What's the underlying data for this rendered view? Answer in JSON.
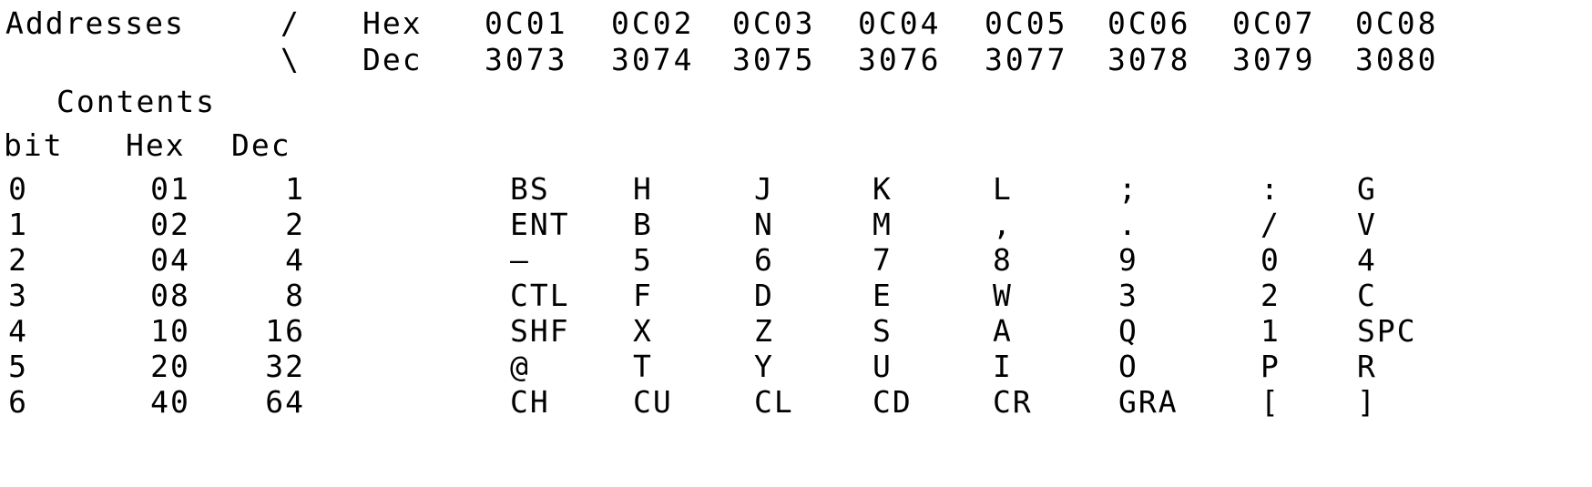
{
  "header": {
    "addresses_label": "Addresses",
    "slash": "/",
    "backslash": "\\",
    "hex_label": "Hex",
    "dec_label": "Dec",
    "hex_addresses": [
      "0C01",
      "0C02",
      "0C03",
      "0C04",
      "0C05",
      "0C06",
      "0C07",
      "0C08"
    ],
    "dec_addresses": [
      "3073",
      "3074",
      "3075",
      "3076",
      "3077",
      "3078",
      "3079",
      "3080"
    ]
  },
  "contents": {
    "label": "Contents",
    "col_bit": "bit",
    "col_hex": "Hex",
    "col_dec": "Dec"
  },
  "rows": [
    {
      "bit": "0",
      "hex": "01",
      "dec": "1",
      "keys": [
        "BS",
        "H",
        "J",
        "K",
        "L",
        ";",
        ":",
        "G"
      ]
    },
    {
      "bit": "1",
      "hex": "02",
      "dec": "2",
      "keys": [
        "ENT",
        "B",
        "N",
        "M",
        ",",
        ".",
        "/",
        "V"
      ]
    },
    {
      "bit": "2",
      "hex": "04",
      "dec": "4",
      "keys": [
        "—",
        "5",
        "6",
        "7",
        "8",
        "9",
        "0",
        "4"
      ]
    },
    {
      "bit": "3",
      "hex": "08",
      "dec": "8",
      "keys": [
        "CTL",
        "F",
        "D",
        "E",
        "W",
        "3",
        "2",
        "C"
      ]
    },
    {
      "bit": "4",
      "hex": "10",
      "dec": "16",
      "keys": [
        "SHF",
        "X",
        "Z",
        "S",
        "A",
        "Q",
        "1",
        "SPC"
      ]
    },
    {
      "bit": "5",
      "hex": "20",
      "dec": "32",
      "keys": [
        "@",
        "T",
        "Y",
        "U",
        "I",
        "O",
        "P",
        "R"
      ]
    },
    {
      "bit": "6",
      "hex": "40",
      "dec": "64",
      "keys": [
        "CH",
        "CU",
        "CL",
        "CD",
        "CR",
        "GRA",
        "[",
        "]"
      ]
    }
  ]
}
